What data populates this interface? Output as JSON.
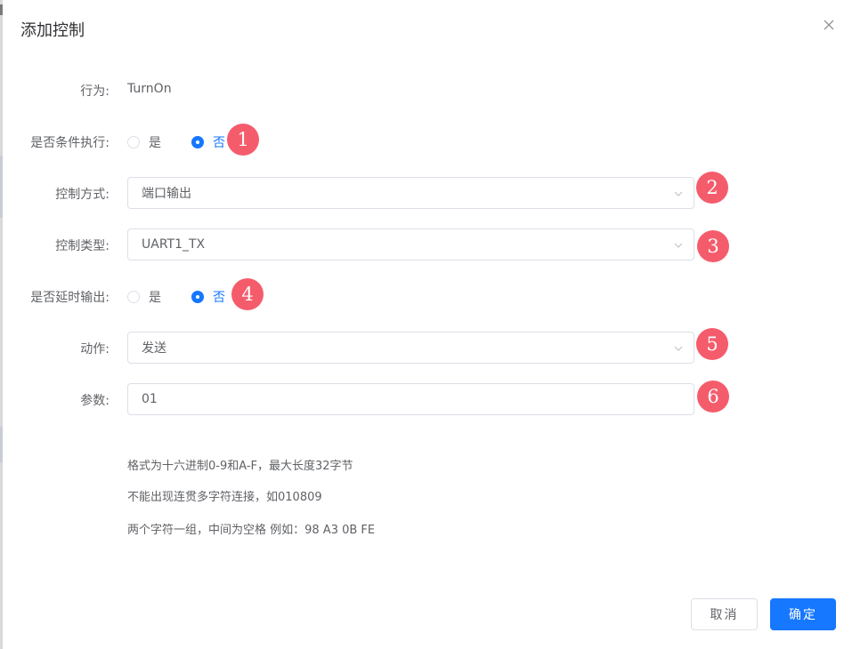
{
  "dialog": {
    "title": "添加控制"
  },
  "form": {
    "behavior": {
      "label": "行为:",
      "value": "TurnOn"
    },
    "conditional": {
      "label": "是否条件执行:",
      "options": [
        "是",
        "否"
      ],
      "selected": "否",
      "badge": "1"
    },
    "control_mode": {
      "label": "控制方式:",
      "value": "端口输出",
      "badge": "2"
    },
    "control_type": {
      "label": "控制类型:",
      "value": "UART1_TX",
      "badge": "3"
    },
    "delayed_output": {
      "label": "是否延时输出:",
      "options": [
        "是",
        "否"
      ],
      "selected": "否",
      "badge": "4"
    },
    "action": {
      "label": "动作:",
      "value": "发送",
      "badge": "5"
    },
    "param": {
      "label": "参数:",
      "value": "01",
      "badge": "6"
    },
    "hints": [
      "格式为十六进制0-9和A-F，最大长度32字节",
      "不能出现连贯多字符连接，如010809",
      "两个字符一组，中间为空格 例如：98 A3 0B FE"
    ]
  },
  "footer": {
    "cancel_label": "取消",
    "ok_label": "确定"
  },
  "colors": {
    "primary": "#1677ff",
    "badge": "#f45c6c",
    "text": "#606266",
    "border": "#dcdfe6"
  },
  "icons": {
    "close": "close-icon",
    "select_arrow": "chevron-down-icon"
  }
}
